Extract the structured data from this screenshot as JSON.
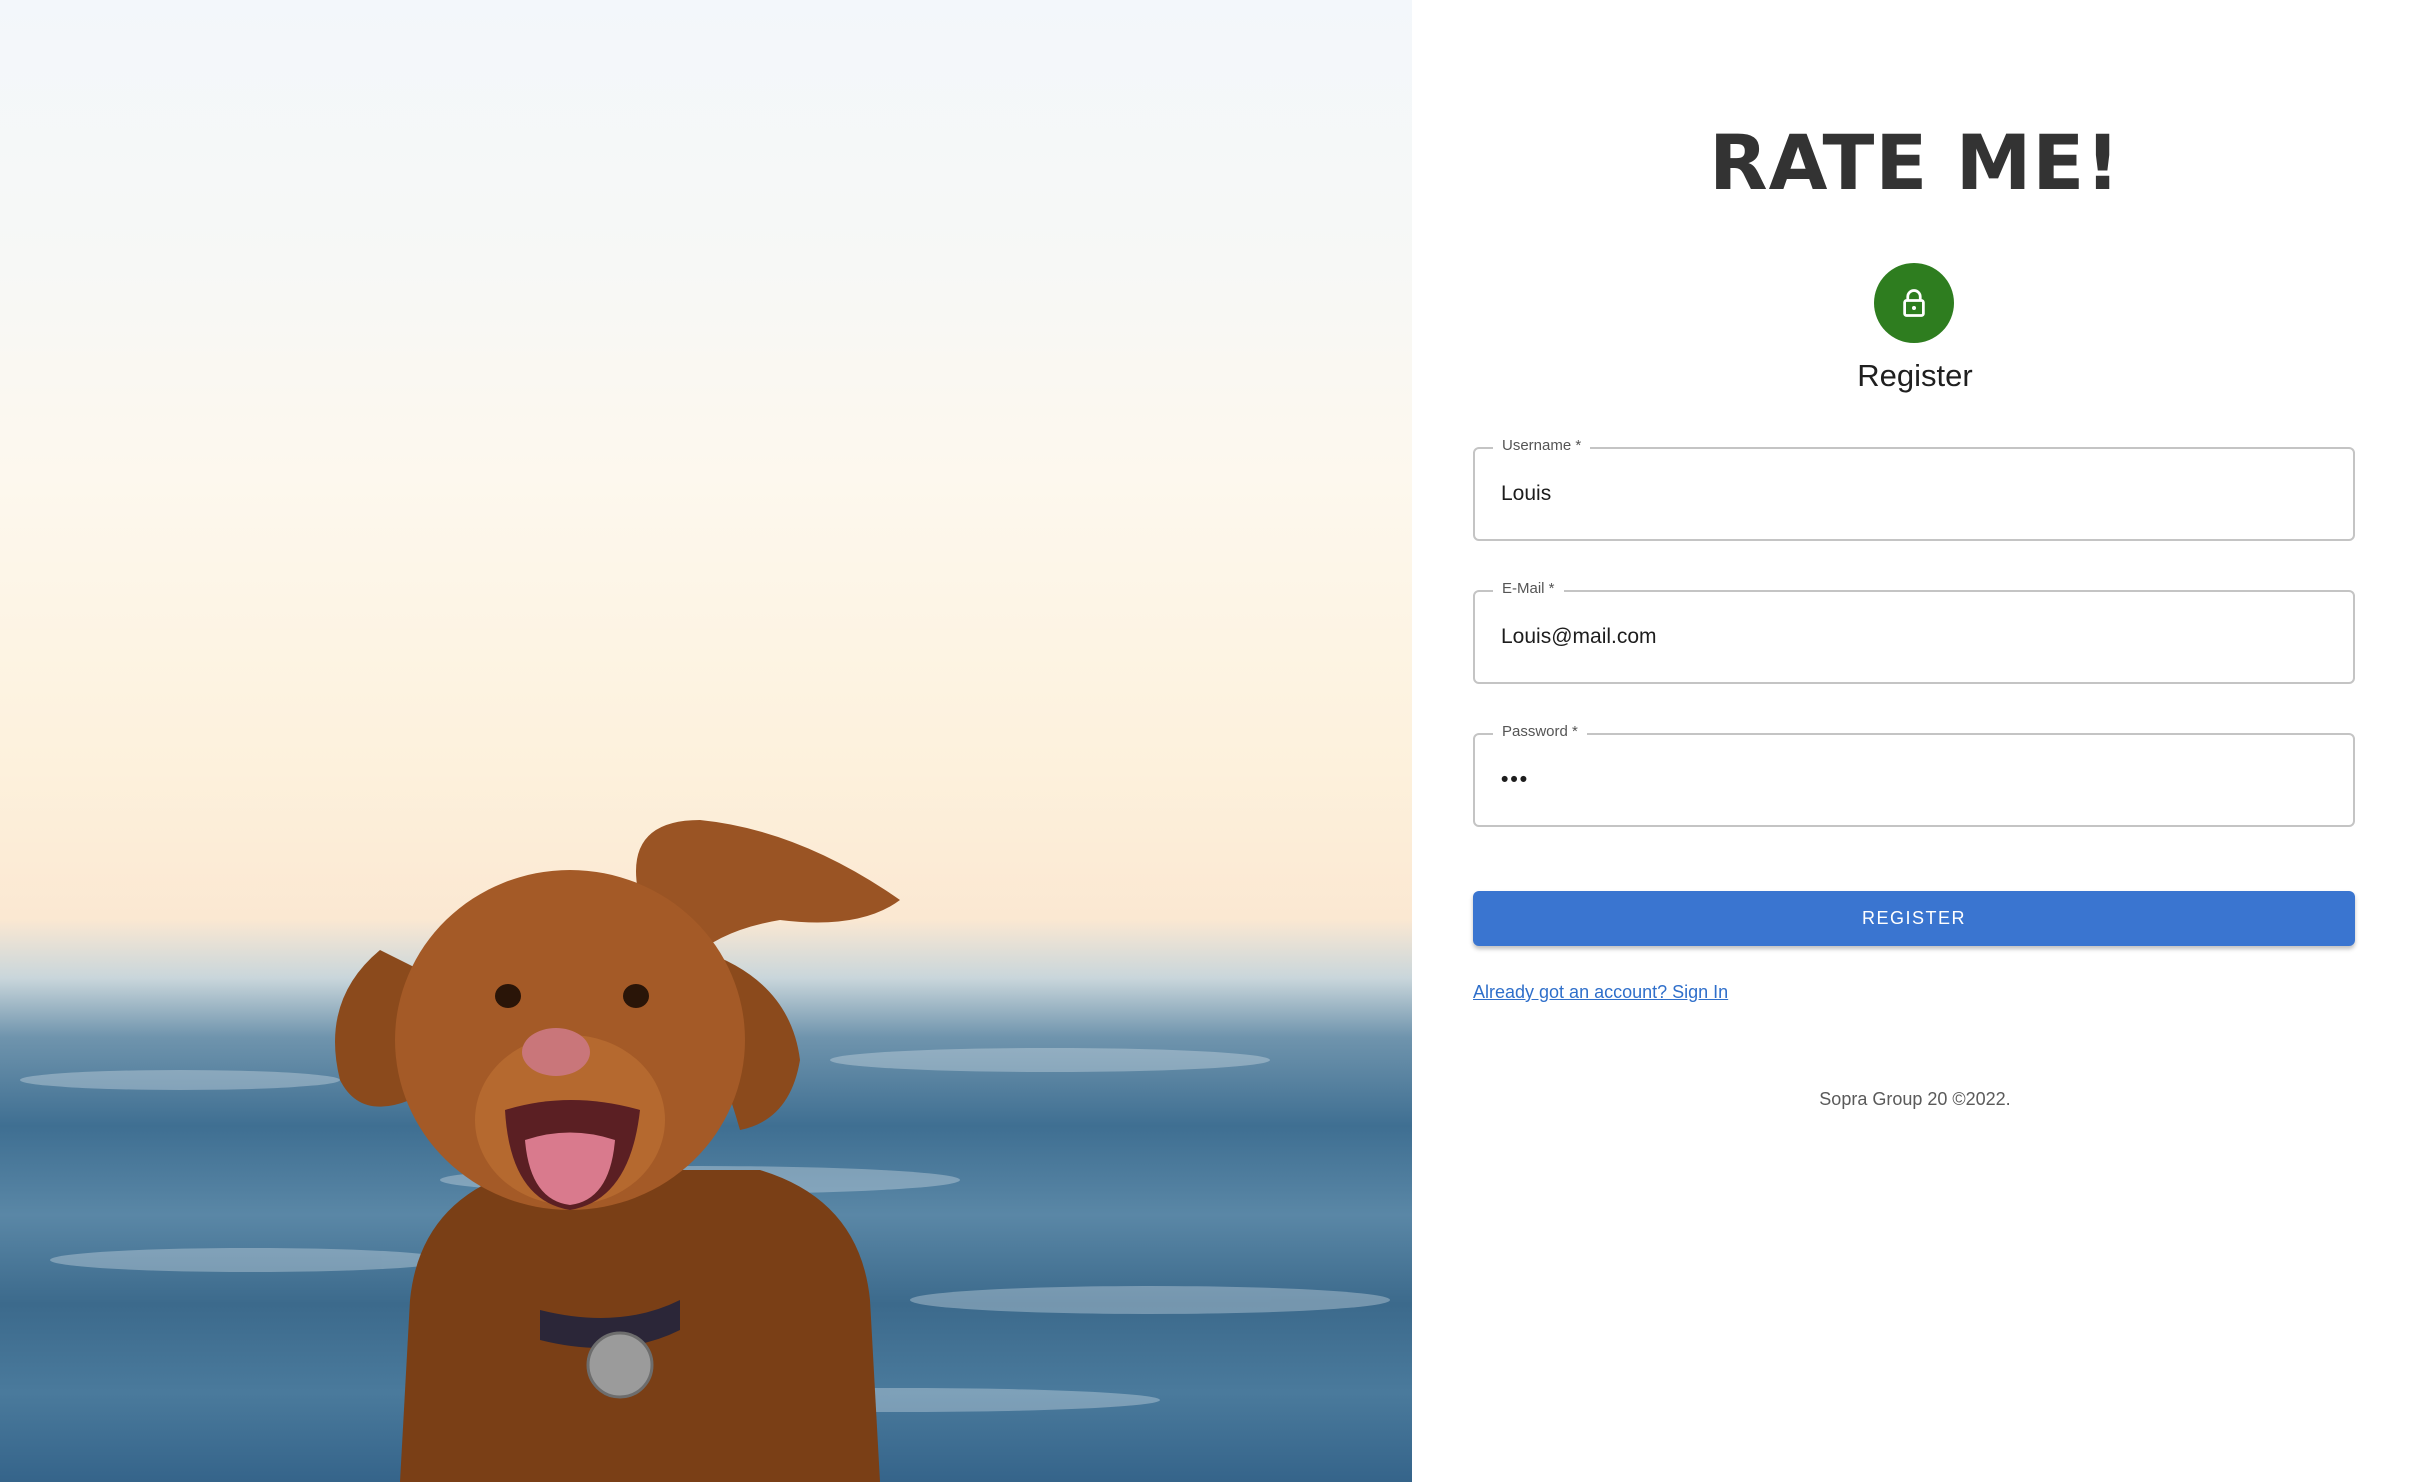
{
  "brand": {
    "title": "RATE ME!"
  },
  "form": {
    "title": "Register",
    "icon": "lock-icon",
    "icon_color": "#2e7d1f",
    "fields": {
      "username": {
        "label": "Username *",
        "value": "Louis"
      },
      "email": {
        "label": "E-Mail *",
        "value": "Louis@mail.com"
      },
      "password": {
        "label": "Password *",
        "value": "•••"
      }
    },
    "submit_label": "REGISTER",
    "submit_color": "#3a75d0",
    "signin_link": "Already got an account? Sign In"
  },
  "footer": {
    "text": "Sopra Group 20 ©2022."
  }
}
